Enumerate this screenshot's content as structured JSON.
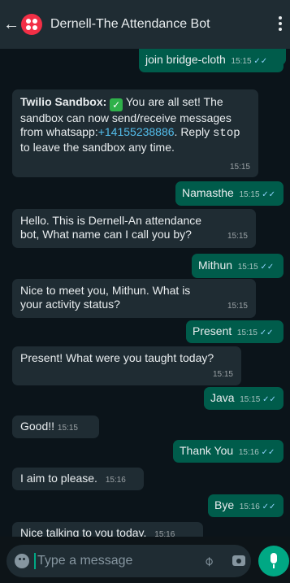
{
  "header": {
    "title": "Dernell-The Attendance Bot",
    "back_icon": "arrow-left-icon",
    "avatar_icon": "twilio-logo-icon",
    "menu_icon": "more-vertical-icon"
  },
  "colors": {
    "outgoing": "#005c4b",
    "incoming": "#1f2c33",
    "background": "#0b141a",
    "accent": "#00a884",
    "read_tick": "#8fd3ff"
  },
  "messages": [
    {
      "dir": "out",
      "text": "join bridge-cloth",
      "time": "15:15",
      "status": "read"
    },
    {
      "dir": "in",
      "sender": "Twilio Sandbox:",
      "text_part1": " You are all set! The sandbox can now send/receive messages from whatsapp:",
      "link": "+14155238886",
      "text_part2": ". Reply ",
      "code": "stop",
      "text_part3": " to leave the sandbox any time.",
      "time": "15:15"
    },
    {
      "dir": "out",
      "text": "Namasthe",
      "time": "15:15",
      "status": "read"
    },
    {
      "dir": "in",
      "text": "Hello. This is Dernell-An attendance bot, What name can I call you by?",
      "time": "15:15"
    },
    {
      "dir": "out",
      "text": "Mithun",
      "time": "15:15",
      "status": "read"
    },
    {
      "dir": "in",
      "text": "Nice to meet you, Mithun. What is your activity status?",
      "time": "15:15"
    },
    {
      "dir": "out",
      "text": "Present",
      "time": "15:15",
      "status": "read"
    },
    {
      "dir": "in",
      "text": "Present! What were you taught today?",
      "time": "15:15"
    },
    {
      "dir": "out",
      "text": "Java",
      "time": "15:15",
      "status": "read"
    },
    {
      "dir": "in",
      "text": "Good!!",
      "time": "15:15"
    },
    {
      "dir": "out",
      "text": "Thank You",
      "time": "15:16",
      "status": "read"
    },
    {
      "dir": "in",
      "text": "I aim to please.",
      "time": "15:16"
    },
    {
      "dir": "out",
      "text": "Bye",
      "time": "15:16",
      "status": "read"
    },
    {
      "dir": "in",
      "text": "Nice talking to you today.",
      "time": "15:16"
    }
  ],
  "composer": {
    "placeholder": "Type a message",
    "emoji_icon": "emoji-icon",
    "attach_icon": "paperclip-icon",
    "camera_icon": "camera-icon",
    "mic_icon": "microphone-icon"
  }
}
